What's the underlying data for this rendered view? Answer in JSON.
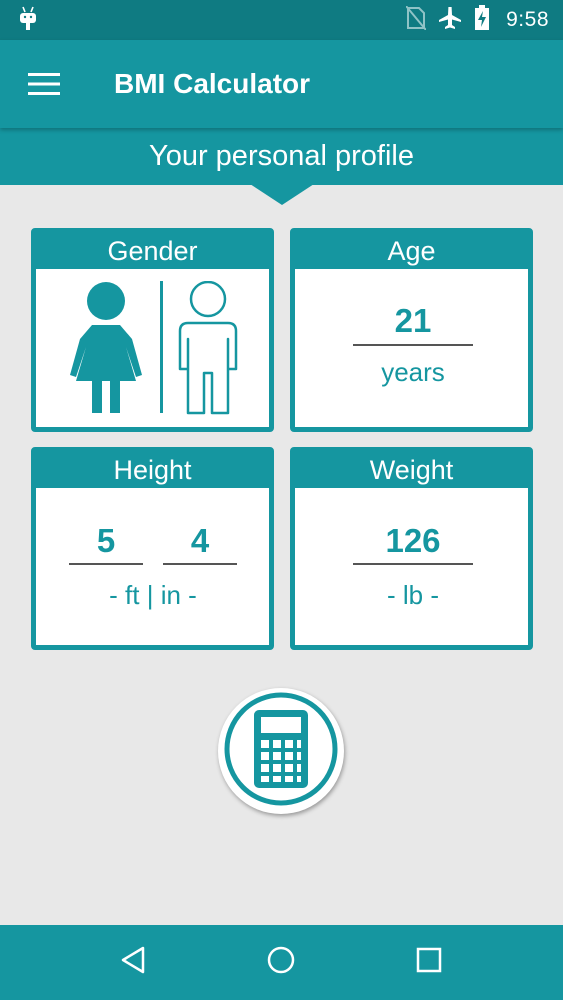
{
  "status_bar": {
    "time": "9:58",
    "icons": [
      "android-icon",
      "no-sim-icon",
      "airplane-mode-icon",
      "battery-charging-icon"
    ]
  },
  "app_bar": {
    "title": "BMI Calculator",
    "menu_icon": "hamburger-menu-icon"
  },
  "profile_banner": {
    "text": "Your personal profile"
  },
  "cards": {
    "gender": {
      "title": "Gender",
      "options": [
        "female-figure-icon",
        "male-figure-icon"
      ]
    },
    "age": {
      "title": "Age",
      "value": "21",
      "unit": "years"
    },
    "height": {
      "title": "Height",
      "feet": "5",
      "inches": "4",
      "unit": "- ft | in -"
    },
    "weight": {
      "title": "Weight",
      "value": "126",
      "unit": "- lb -"
    }
  },
  "calculate_button": {
    "icon": "calculator-icon"
  },
  "nav_bar": {
    "icons": [
      "back-icon",
      "home-icon",
      "recents-icon"
    ]
  },
  "colors": {
    "primary": "#1596a0",
    "primary_dark": "#0f7b82",
    "background": "#e8e8e8"
  }
}
